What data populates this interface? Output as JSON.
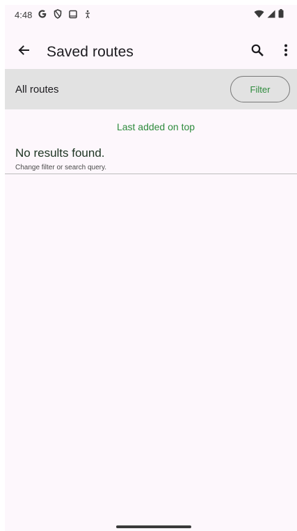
{
  "status_bar": {
    "time": "4:48",
    "icons_left": [
      "google-g-icon",
      "vpn-shield-icon",
      "screen-cast-icon",
      "accessibility-icon"
    ],
    "icons_right": [
      "wifi-icon",
      "cell-signal-icon",
      "battery-icon"
    ]
  },
  "app_bar": {
    "title": "Saved routes",
    "icons": [
      "back-arrow-icon",
      "search-icon",
      "more-vert-icon"
    ]
  },
  "filter_bar": {
    "label": "All routes",
    "filter_button": "Filter"
  },
  "list": {
    "sort_label": "Last added on top",
    "empty_title": "No results found.",
    "empty_subtitle": "Change filter or search query."
  },
  "colors": {
    "background": "#fdf7fc",
    "filter_bar_bg": "#e2e2e2",
    "accent_green": "#2e8b3d",
    "empty_title": "#1c3321"
  }
}
